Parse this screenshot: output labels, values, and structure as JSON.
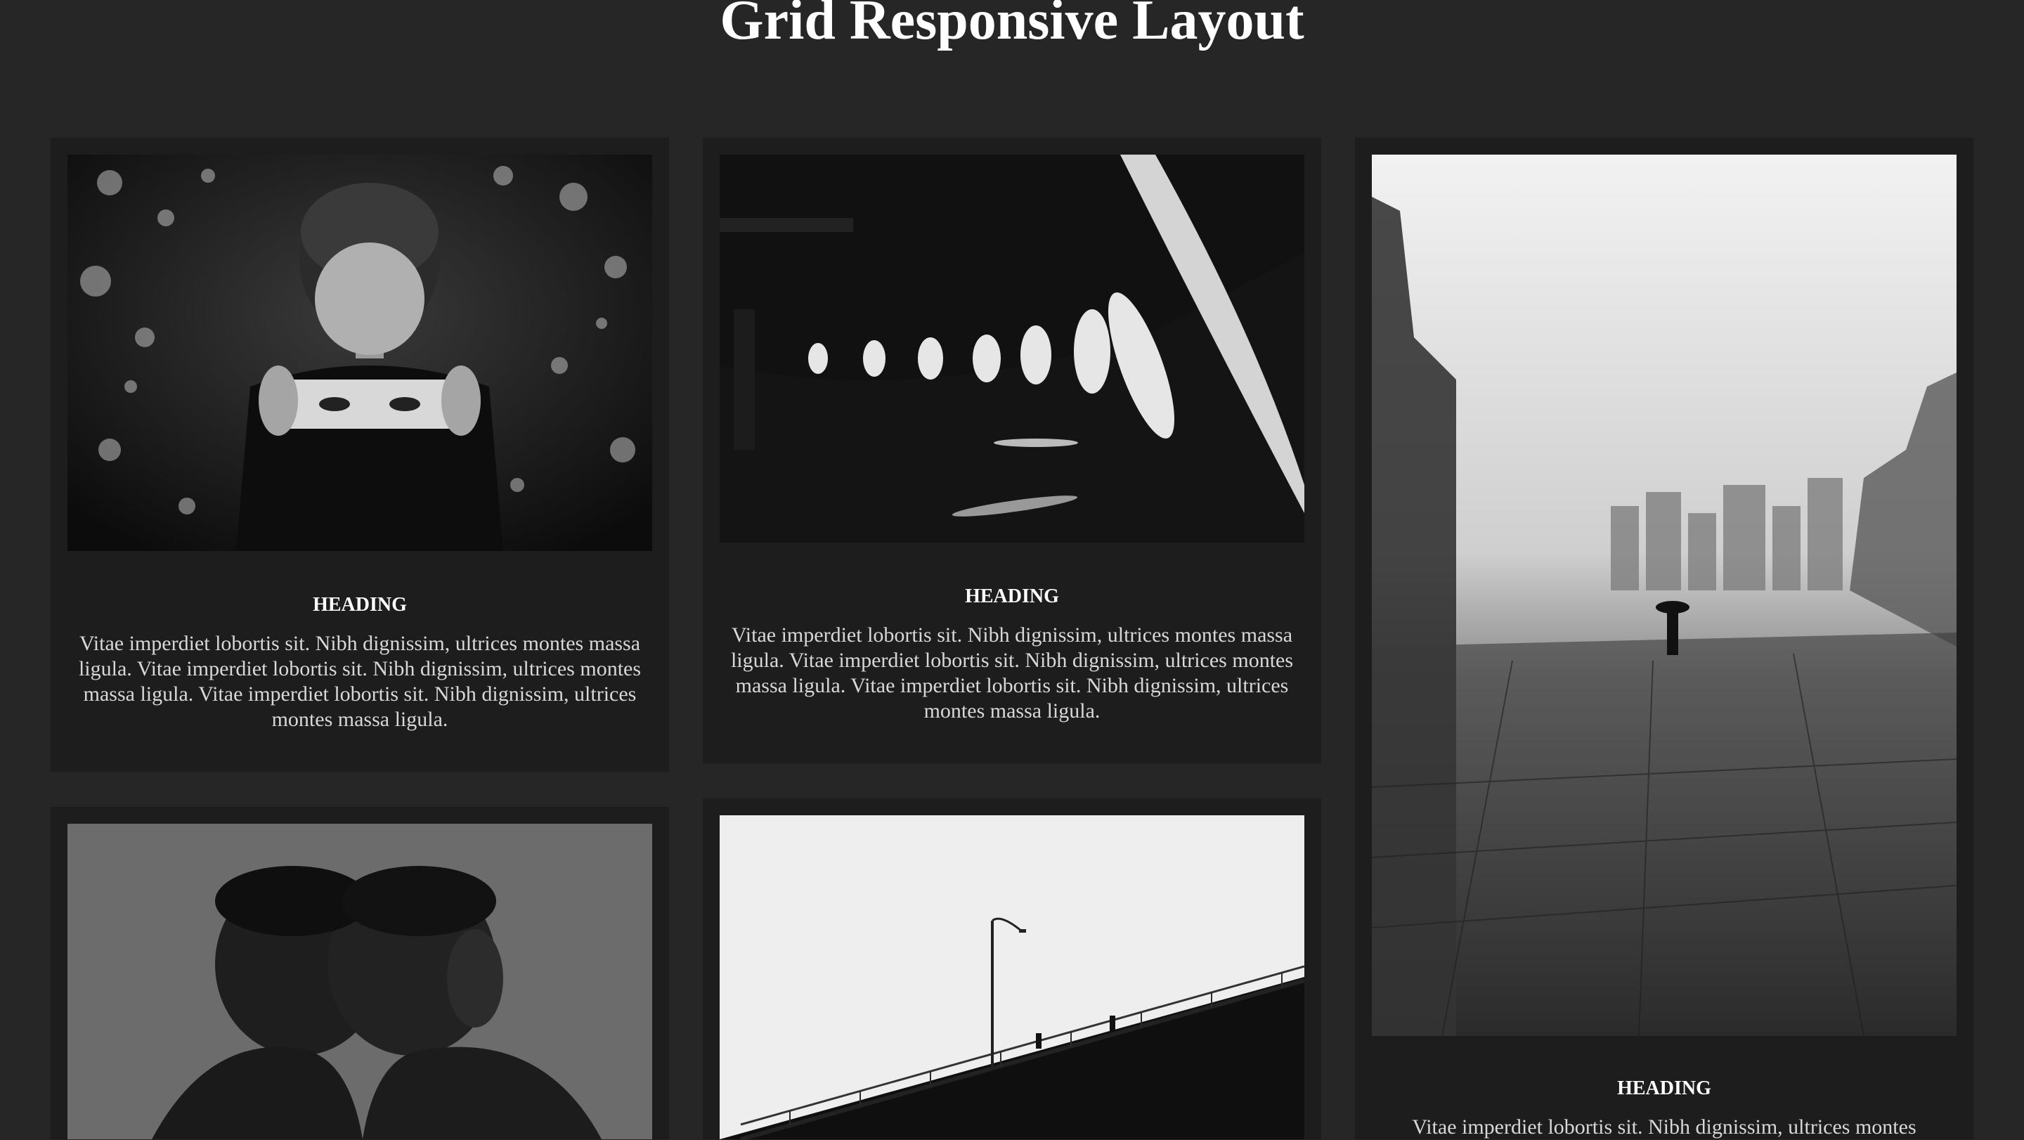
{
  "page": {
    "title": "Grid Responsive Layout"
  },
  "cards": [
    {
      "heading": "HEADING",
      "text": "Vitae imperdiet lobortis sit. Nibh dignissim, ultrices montes massa ligula. Vitae imperdiet lobortis sit. Nibh dignissim, ultrices montes massa ligula. Vitae imperdiet lobortis sit. Nibh dignissim, ultrices montes massa ligula.",
      "image": "woman-holding-mirror-photo"
    },
    {
      "heading": "HEADING",
      "text": "Vitae imperdiet lobortis sit. Nibh dignissim, ultrices montes massa ligula. Vitae imperdiet lobortis sit. Nibh dignissim, ultrices montes massa ligula. Vitae imperdiet lobortis sit. Nibh dignissim, ultrices montes massa ligula.",
      "image": "curved-architecture-photo"
    },
    {
      "heading": "HEADING",
      "text": "Vitae imperdiet lobortis sit. Nibh dignissim, ultrices montes",
      "image": "foggy-street-umbrella-photo"
    },
    {
      "heading": "",
      "text": "",
      "image": "two-men-foreheads-photo"
    },
    {
      "heading": "",
      "text": "",
      "image": "bridge-streetlamp-photo"
    }
  ],
  "colors": {
    "background": "#262626",
    "card": "#1d1d1d",
    "text": "#d8d8d8",
    "heading": "#ffffff"
  }
}
